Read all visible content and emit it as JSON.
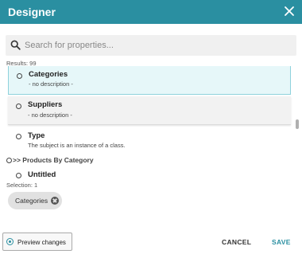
{
  "header": {
    "title": "Designer",
    "close_icon": "close-icon"
  },
  "search": {
    "placeholder": "Search for properties...",
    "value": "",
    "icon": "search-icon"
  },
  "results_label": "Results: 99",
  "list": {
    "items": [
      {
        "name": "Categories",
        "description": "- no description -",
        "selected": true
      },
      {
        "name": "Suppliers",
        "description": "- no description -",
        "selected": false
      },
      {
        "name": "Type",
        "description": "The subject is an instance of a class.",
        "selected": false
      }
    ],
    "group": {
      "label": ">> Products By Category"
    },
    "group_items": [
      {
        "name": "Untitled",
        "description": ""
      }
    ]
  },
  "selection_label": "Selection: 1",
  "selected_chips": [
    {
      "label": "Categories",
      "remove_icon": "remove-chip-icon"
    }
  ],
  "footer": {
    "preview_label": "Preview changes",
    "cancel_label": "CANCEL",
    "save_label": "SAVE"
  },
  "colors": {
    "accent": "#2a8fa1",
    "selected_bg": "#e6f7f9",
    "selected_border": "#8fd2dc"
  }
}
